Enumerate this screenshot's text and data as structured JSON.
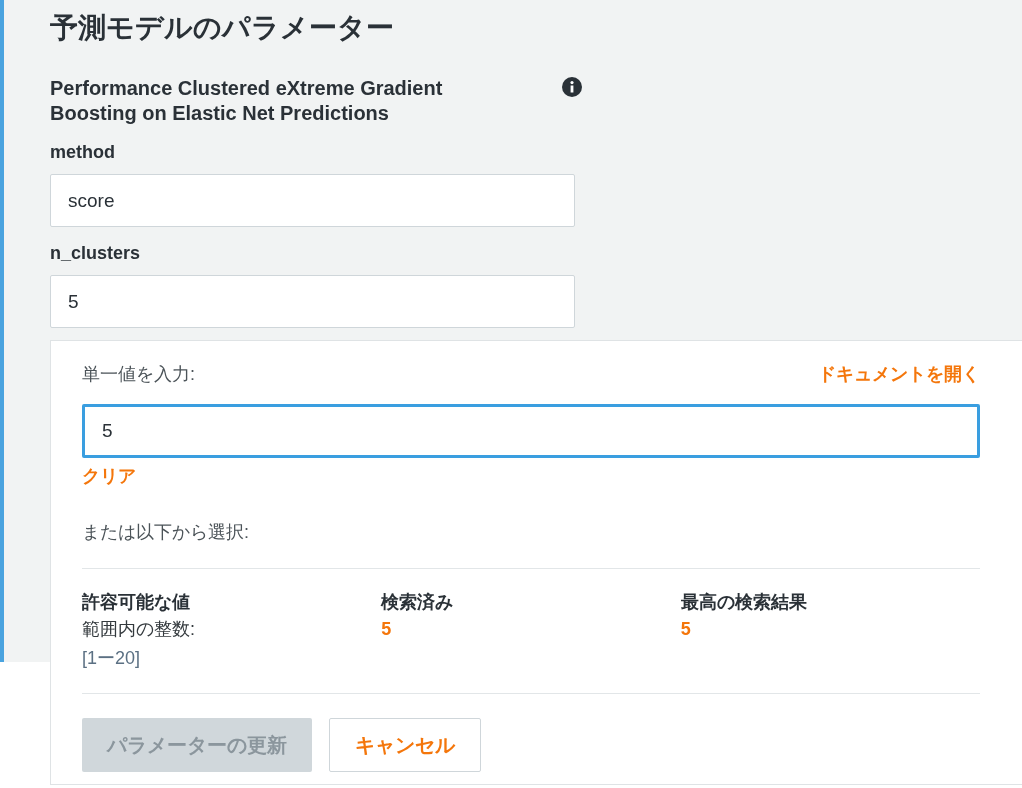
{
  "title": "予測モデルのパラメーター",
  "model_name": "Performance Clustered eXtreme Gradient Boosting on Elastic Net Predictions",
  "fields": [
    {
      "label": "method",
      "value": "score"
    },
    {
      "label": "n_clusters",
      "value": "5"
    }
  ],
  "popover": {
    "label": "単一値を入力:",
    "docs_link": "ドキュメントを開く",
    "input": {
      "value": "5",
      "focused": true
    },
    "clear": "クリア",
    "or_choose": "または以下から選択:",
    "columns": [
      {
        "heading": "許容可能な値",
        "lines": [
          {
            "kind": "plain",
            "text": "範囲内の整数:"
          },
          {
            "kind": "range",
            "text": "[1ー20]"
          }
        ]
      },
      {
        "heading": "検索済み",
        "lines": [
          {
            "kind": "highlight",
            "text": "5"
          }
        ]
      },
      {
        "heading": "最高の検索結果",
        "lines": [
          {
            "kind": "highlight",
            "text": "5"
          }
        ]
      }
    ],
    "buttons": [
      {
        "label": "パラメーターの更新",
        "disabled": true
      },
      {
        "label": "キャンセル",
        "disabled": false
      }
    ]
  }
}
